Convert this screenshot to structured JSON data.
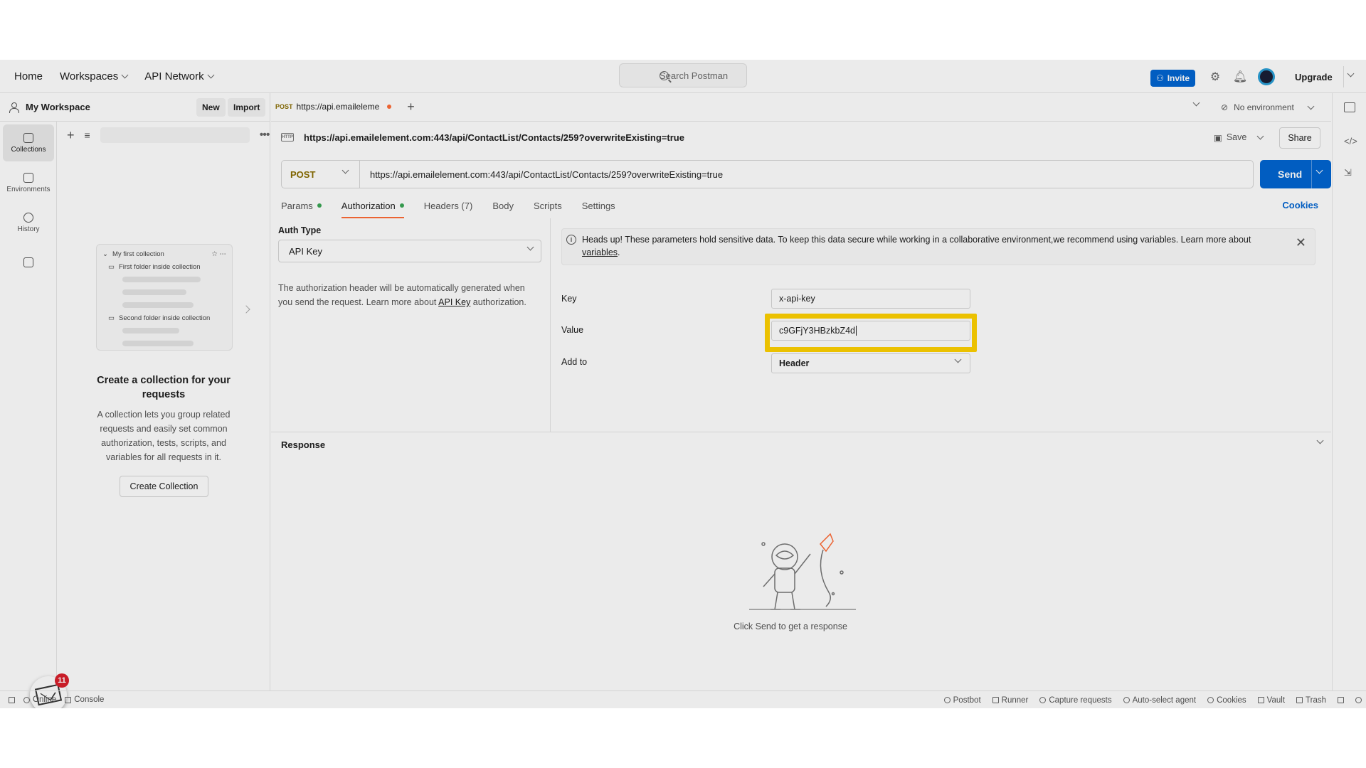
{
  "topnav": {
    "home": "Home",
    "workspaces": "Workspaces",
    "api_network": "API Network",
    "search_placeholder": "Search Postman",
    "invite": "Invite",
    "upgrade": "Upgrade"
  },
  "sidebar": {
    "workspace_name": "My Workspace",
    "new_label": "New",
    "import_label": "Import",
    "rail": [
      {
        "label": "Collections",
        "icon": "collections-icon"
      },
      {
        "label": "Environments",
        "icon": "environments-icon"
      },
      {
        "label": "History",
        "icon": "history-icon"
      }
    ],
    "illustration": {
      "collection": "My first collection",
      "folder1": "First folder inside collection",
      "folder2": "Second folder inside collection"
    },
    "empty_title": "Create a collection for your requests",
    "empty_desc": "A collection lets you group related requests and easily set common authorization, tests, scripts, and variables for all requests in it.",
    "create_button": "Create Collection",
    "notification_count": "11"
  },
  "main": {
    "tab": {
      "method": "POST",
      "title": "https://api.emaileleme"
    },
    "environment": "No environment",
    "url_title": "https://api.emailelement.com:443/api/ContactList/Contacts/259?overwriteExisting=true",
    "save": "Save",
    "share": "Share",
    "method": "POST",
    "url": "https://api.emailelement.com:443/api/ContactList/Contacts/259?overwriteExisting=true",
    "send": "Send",
    "subtabs": {
      "params": "Params",
      "authorization": "Authorization",
      "headers": "Headers (7)",
      "body": "Body",
      "scripts": "Scripts",
      "settings": "Settings"
    },
    "cookies": "Cookies",
    "auth": {
      "type_label": "Auth Type",
      "type_value": "API Key",
      "desc_pre": "The authorization header will be automatically generated when you send the request. Learn more about ",
      "desc_link": "API Key",
      "desc_post": " authorization.",
      "alert_text": "Heads up! These parameters hold sensitive data. To keep this data secure while working in a collaborative environment,we recommend using variables. Learn more about ",
      "alert_link": "variables",
      "alert_end": ".",
      "key_label": "Key",
      "key_value": "x-api-key",
      "value_label": "Value",
      "value_value": "c9GFjY3HBzkbZ4d",
      "addto_label": "Add to",
      "addto_value": "Header"
    },
    "response_title": "Response",
    "response_hint": "Click Send to get a response"
  },
  "footer": {
    "online": "Online",
    "console": "Console",
    "postbot": "Postbot",
    "runner": "Runner",
    "capture": "Capture requests",
    "agent": "Auto-select agent",
    "cookies": "Cookies",
    "vault": "Vault",
    "trash": "Trash"
  },
  "colors": {
    "accent": "#0265d2",
    "highlight": "#ffd200",
    "brand_orange": "#ff6c37"
  }
}
